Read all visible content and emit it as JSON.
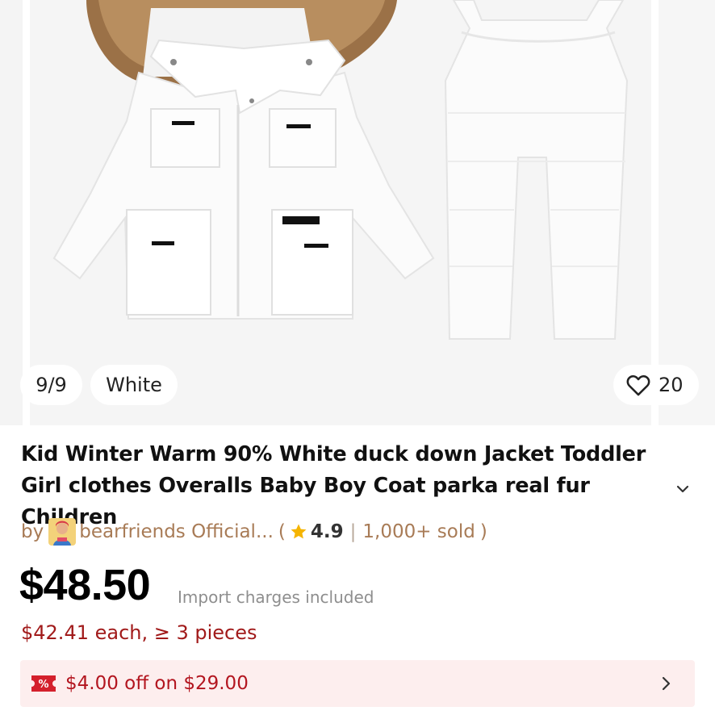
{
  "gallery": {
    "counter": "9/9",
    "selected_color": "White",
    "favorite_count": "20"
  },
  "product": {
    "title": "Kid Winter Warm 90% White duck down Jacket Toddler Girl clothes Overalls Baby Boy Coat parka real fur Children"
  },
  "store": {
    "by_label": "by",
    "name": "bearfriends Official...",
    "open_paren": "(",
    "rating": "4.9",
    "separator": "|",
    "sold": "1,000+ sold",
    "close_paren": ")"
  },
  "pricing": {
    "price": "$48.50",
    "import_note": "Import charges included",
    "bulk_price": "$42.41 each, ≥ 3 pieces"
  },
  "coupon": {
    "badge": "%",
    "text": "$4.00 off on $29.00"
  },
  "icons": {
    "favorite": "heart-outline-icon",
    "expand": "chevron-down-icon",
    "rating": "star-icon",
    "coupon": "coupon-tag-icon",
    "coupon_more": "chevron-right-icon"
  },
  "colors": {
    "accent_red": "#b3151f",
    "store_brown": "#a87b56",
    "coupon_bg": "#fdeeee",
    "star": "#f5b400"
  }
}
